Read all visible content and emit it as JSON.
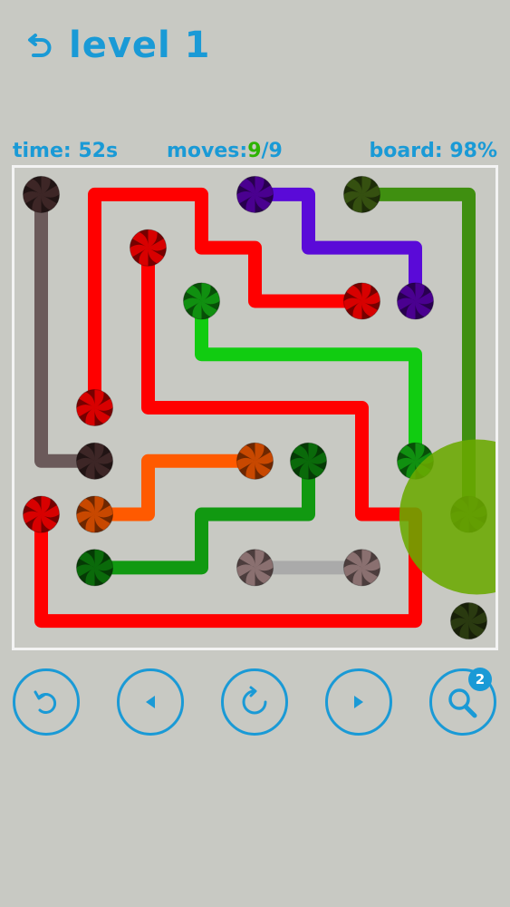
{
  "header": {
    "title": "level 1",
    "back_icon": "back-arrow-icon"
  },
  "stats": {
    "time_label": "time:",
    "time_value": "52s",
    "moves_label": "moves:",
    "moves_current": "9",
    "moves_total": "/9",
    "board_label": "board:",
    "board_value": "98%"
  },
  "board": {
    "grid_size": 9,
    "colors": {
      "border": "#f3f3f3",
      "accent": "#1a9ad6"
    },
    "pipes": [
      {
        "name": "brown",
        "color": "#6b5a5a",
        "dot": "#3d2626",
        "path": [
          [
            0,
            0
          ],
          [
            0,
            5
          ],
          [
            1,
            5
          ]
        ]
      },
      {
        "name": "red-top",
        "color": "#ff0000",
        "dot": "#d80000",
        "path": [
          [
            1,
            4
          ],
          [
            1,
            0
          ],
          [
            3,
            0
          ],
          [
            3,
            1
          ],
          [
            4,
            1
          ],
          [
            4,
            2
          ],
          [
            6,
            2
          ]
        ]
      },
      {
        "name": "red-long",
        "color": "#ff0000",
        "dot": "#d80000",
        "path": [
          [
            2,
            1
          ],
          [
            2,
            4
          ],
          [
            6,
            4
          ],
          [
            6,
            6
          ],
          [
            7,
            6
          ],
          [
            7,
            8
          ],
          [
            0,
            8
          ],
          [
            0,
            6
          ]
        ]
      },
      {
        "name": "purple",
        "color": "#5a0ad8",
        "dot": "#4a0090",
        "path": [
          [
            4,
            0
          ],
          [
            5,
            0
          ],
          [
            5,
            1
          ],
          [
            7,
            1
          ],
          [
            7,
            2
          ]
        ]
      },
      {
        "name": "olive-green",
        "color": "#3f8f10",
        "dot": "#355010",
        "path": [
          [
            6,
            0
          ],
          [
            8,
            0
          ],
          [
            8,
            6
          ]
        ]
      },
      {
        "name": "green",
        "color": "#11cc11",
        "dot": "#109010",
        "path": [
          [
            3,
            2
          ],
          [
            3,
            3
          ],
          [
            7,
            3
          ],
          [
            7,
            5
          ]
        ]
      },
      {
        "name": "orange",
        "color": "#ff5a00",
        "dot": "#c84800",
        "path": [
          [
            1,
            6
          ],
          [
            2,
            6
          ],
          [
            2,
            5
          ],
          [
            4,
            5
          ]
        ]
      },
      {
        "name": "dark-green",
        "color": "#119911",
        "dot": "#0a6a0a",
        "path": [
          [
            1,
            7
          ],
          [
            3,
            7
          ],
          [
            3,
            6
          ],
          [
            5,
            6
          ],
          [
            5,
            5
          ]
        ]
      },
      {
        "name": "grey",
        "color": "#aaaaaa",
        "dot": "#8a7070",
        "path": [
          [
            4,
            7
          ],
          [
            6,
            7
          ]
        ]
      }
    ],
    "extra_dots": [
      {
        "cell": [
          8,
          8
        ],
        "dot": "#2a3a10"
      }
    ],
    "touch": {
      "cell": [
        8.15,
        6.05
      ],
      "color": "#6aa800"
    }
  },
  "controls": {
    "undo_icon": "undo-icon",
    "prev_icon": "previous-level-icon",
    "restart_icon": "restart-icon",
    "next_icon": "next-level-icon",
    "hint_icon": "hint-search-icon",
    "hint_count": "2"
  }
}
